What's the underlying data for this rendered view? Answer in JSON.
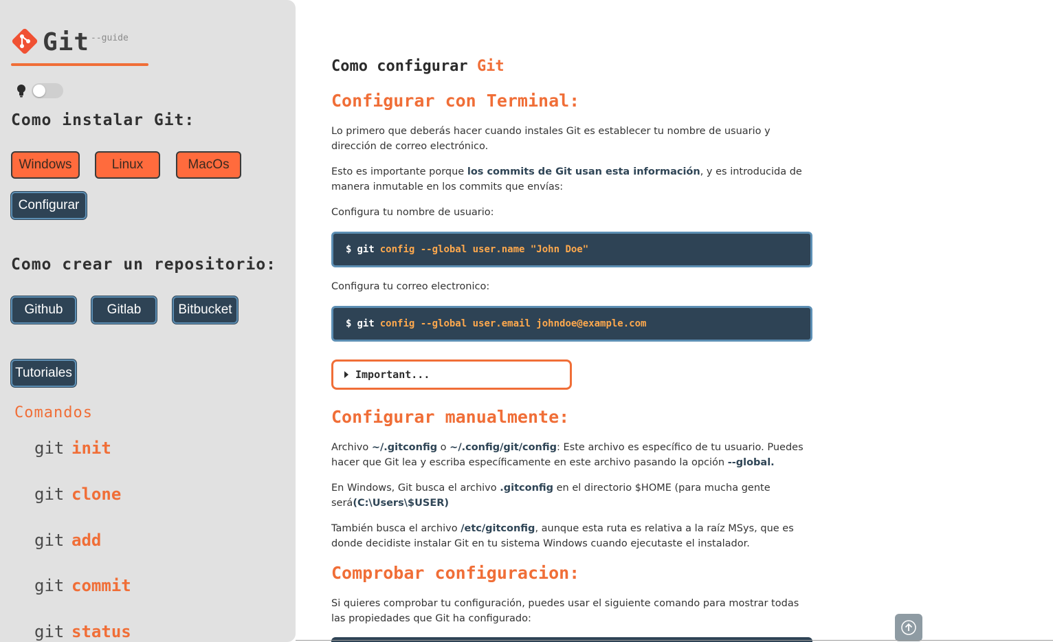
{
  "brand": {
    "name": "Git",
    "suffix": "--guide"
  },
  "sidebar": {
    "install_heading": "Como instalar Git:",
    "install_buttons": [
      "Windows",
      "Linux",
      "MacOs"
    ],
    "configure_button": "Configurar",
    "repo_heading": "Como crear un repositorio:",
    "repo_buttons": [
      "Github",
      "Gitlab",
      "Bitbucket"
    ],
    "tutorials_button": "Tutoriales",
    "commands_title": "Comandos",
    "commands": [
      {
        "prefix": "git",
        "name": "init"
      },
      {
        "prefix": "git",
        "name": "clone"
      },
      {
        "prefix": "git",
        "name": "add"
      },
      {
        "prefix": "git",
        "name": "commit"
      },
      {
        "prefix": "git",
        "name": "status"
      }
    ]
  },
  "main": {
    "title_prefix": "Como configurar",
    "title_accent": "Git",
    "sec1_heading": "Configurar con Terminal:",
    "p1": "Lo primero que deberás hacer cuando instales Git es establecer tu nombre de usuario y dirección de correo electrónico.",
    "p2_before": "Esto es importante porque ",
    "p2_bold": "los commits de Git usan esta información",
    "p2_after": ", y es introducida de manera inmutable en los commits que envías:",
    "label_username": "Configura tu nombre de usuario:",
    "code1": {
      "prompt": "$",
      "git": "git",
      "rest": "config --global user.name \"John Doe\""
    },
    "label_email": "Configura tu correo electronico:",
    "code2": {
      "prompt": "$",
      "git": "git",
      "rest": "config --global user.email johndoe@example.com"
    },
    "details_label": "Important...",
    "sec2_heading": "Configurar manualmente:",
    "p3_a": "Archivo ",
    "p3_b1": "~/.gitconfig",
    "p3_o": " o ",
    "p3_b2": "~/.config/git/config",
    "p3_c": ": Este archivo es específico de tu usuario. Puedes hacer que Git lea y escriba específicamente en este archivo pasando la opción ",
    "p3_b3": "--global.",
    "p4_a": "En Windows, Git busca el archivo ",
    "p4_b1": ".gitconfig",
    "p4_c": " en el directorio $HOME (para mucha gente será",
    "p4_b2": "(C:\\Users\\$USER)",
    "p5_a": "También busca el archivo ",
    "p5_b1": "/etc/gitconfig",
    "p5_c": ", aunque esta ruta es relativa a la raíz MSys, que es donde decidiste instalar Git en tu sistema Windows cuando ejecutaste el instalador.",
    "sec3_heading": "Comprobar configuracion:",
    "p6": "Si quieres comprobar tu configuración, puedes usar el siguiente comando para mostrar todas las propiedades que Git ha configurado:"
  },
  "colors": {
    "accent": "#f06e37",
    "dark": "#2e4355",
    "sidebar_bg": "#e1e1e1"
  },
  "icons": {
    "logo": "git-logo-icon",
    "bulb": "lightbulb-icon",
    "scroll": "arrow-up-icon",
    "caret": "caret-right-icon"
  }
}
